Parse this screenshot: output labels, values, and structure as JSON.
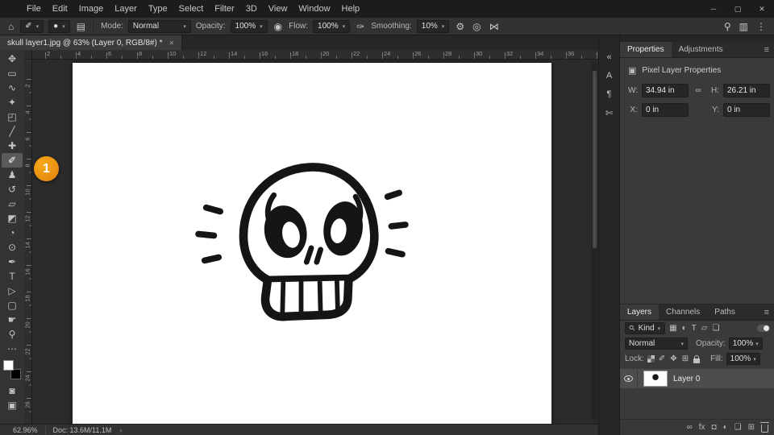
{
  "icons": {
    "home": "⌂",
    "chevron": "▾",
    "brush_preset": "✐",
    "brush_size_dot": "●",
    "brush_panel": "▤",
    "airbrush_opacity": "◉",
    "airbrush": "✑",
    "gear": "⚙",
    "pressure_size": "◎",
    "symmetry": "⋈",
    "search": "⚲",
    "workspace": "▥",
    "extras": "⋮",
    "link": "∞",
    "panel_menu": "≡",
    "image": "▣",
    "kind_search": "⚲",
    "ellipsis": "⋯",
    "quick_mask": "◙",
    "screen_mode": "▣",
    "status_chevron": "›"
  },
  "titlebar": {
    "menus": [
      "File",
      "Edit",
      "Image",
      "Layer",
      "Type",
      "Select",
      "Filter",
      "3D",
      "View",
      "Window",
      "Help"
    ],
    "window_controls": [
      {
        "name": "minimize-button",
        "glyph": "─"
      },
      {
        "name": "maximize-button",
        "glyph": "▢"
      },
      {
        "name": "close-button",
        "glyph": "✕"
      }
    ]
  },
  "options_bar": {
    "mode_label": "Mode:",
    "mode_value": "Normal",
    "opacity_label": "Opacity:",
    "opacity_value": "100%",
    "flow_label": "Flow:",
    "flow_value": "100%",
    "smoothing_label": "Smoothing:",
    "smoothing_value": "10%"
  },
  "document_tab": {
    "title": "skull layer1.jpg @ 63% (Layer 0, RGB/8#) *",
    "close_glyph": "✕"
  },
  "rulers": {
    "top_numbers": [
      "2",
      "4",
      "6",
      "8",
      "10",
      "12",
      "14",
      "16",
      "18",
      "20",
      "22",
      "24",
      "26",
      "28",
      "30",
      "32",
      "34",
      "36"
    ],
    "left_numbers": [
      "2",
      "4",
      "6",
      "8",
      "10",
      "12",
      "14",
      "16",
      "18",
      "20",
      "22",
      "24",
      "26"
    ]
  },
  "toolbar": {
    "tools": [
      {
        "name": "move-tool",
        "glyph": "✥",
        "active": false
      },
      {
        "name": "rectangular-marquee-tool",
        "glyph": "▭",
        "active": false
      },
      {
        "name": "lasso-tool",
        "glyph": "∿",
        "active": false
      },
      {
        "name": "quick-selection-tool",
        "glyph": "✦",
        "active": false
      },
      {
        "name": "crop-tool",
        "glyph": "◰",
        "active": false
      },
      {
        "name": "eyedropper-tool",
        "glyph": "╱",
        "active": false
      },
      {
        "name": "spot-healing-brush-tool",
        "glyph": "✚",
        "active": false
      },
      {
        "name": "brush-tool",
        "glyph": "✐",
        "active": true
      },
      {
        "name": "clone-stamp-tool",
        "glyph": "♟",
        "active": false
      },
      {
        "name": "history-brush-tool",
        "glyph": "↺",
        "active": false
      },
      {
        "name": "eraser-tool",
        "glyph": "▱",
        "active": false
      },
      {
        "name": "gradient-tool",
        "glyph": "◩",
        "active": false
      },
      {
        "name": "blur-tool",
        "glyph": "◔",
        "active": false
      },
      {
        "name": "dodge-tool",
        "glyph": "⊙",
        "active": false
      },
      {
        "name": "pen-tool",
        "glyph": "✒",
        "active": false
      },
      {
        "name": "type-tool",
        "glyph": "T",
        "active": false
      },
      {
        "name": "path-selection-tool",
        "glyph": "▷",
        "active": false
      },
      {
        "name": "rectangle-tool",
        "glyph": "▢",
        "active": false
      },
      {
        "name": "hand-tool",
        "glyph": "☛",
        "active": false
      },
      {
        "name": "zoom-tool",
        "glyph": "⚲",
        "active": false
      }
    ],
    "foreground_color": "#ffffff",
    "background_color": "#000000"
  },
  "callout": {
    "number": "1",
    "color": "#e8890c"
  },
  "dock_strip": {
    "icons": [
      {
        "name": "expand-panels-icon",
        "glyph": "«"
      },
      {
        "name": "character-panel-icon",
        "glyph": "A"
      },
      {
        "name": "paragraph-panel-icon",
        "glyph": "¶"
      },
      {
        "name": "scissors-panel-icon",
        "glyph": "✄"
      }
    ]
  },
  "properties_panel": {
    "tabs": [
      {
        "label": "Properties",
        "active": true
      },
      {
        "label": "Adjustments",
        "active": false
      }
    ],
    "title": "Pixel Layer Properties",
    "w_label": "W:",
    "w_value": "34.94 in",
    "h_label": "H:",
    "h_value": "26.21 in",
    "x_label": "X:",
    "x_value": "0 in",
    "y_label": "Y:",
    "y_value": "0 in"
  },
  "layers_panel": {
    "tabs": [
      {
        "label": "Layers",
        "active": true
      },
      {
        "label": "Channels",
        "active": false
      },
      {
        "label": "Paths",
        "active": false
      }
    ],
    "kind_label": "Kind",
    "filter_icons": [
      {
        "name": "filter-pixel-layers-icon",
        "glyph": "▦"
      },
      {
        "name": "filter-adjustment-layers-icon",
        "glyph": "◐"
      },
      {
        "name": "filter-type-layers-icon",
        "glyph": "T"
      },
      {
        "name": "filter-shape-layers-icon",
        "glyph": "▱"
      },
      {
        "name": "filter-smart-objects-icon",
        "glyph": "❏"
      }
    ],
    "blend_mode": "Normal",
    "opacity_label": "Opacity:",
    "opacity_value": "100%",
    "lock_label": "Lock:",
    "lock_icons": [
      {
        "name": "lock-pixels-icon",
        "glyph": "✐"
      },
      {
        "name": "lock-position-icon",
        "glyph": "✥"
      },
      {
        "name": "lock-artboard-icon",
        "glyph": "⊞"
      }
    ],
    "fill_label": "Fill:",
    "fill_value": "100%",
    "layer_name": "Layer 0",
    "bottom_icons": [
      {
        "name": "link-layers-icon",
        "glyph": "∞"
      },
      {
        "name": "layer-style-icon",
        "glyph": "fx"
      },
      {
        "name": "add-mask-icon",
        "glyph": "◘"
      },
      {
        "name": "adjustment-layer-icon",
        "glyph": "◐"
      },
      {
        "name": "new-group-icon",
        "glyph": "❏"
      },
      {
        "name": "new-layer-icon",
        "glyph": "⊞"
      }
    ]
  },
  "status_bar": {
    "zoom": "62.96%",
    "doc": "Doc: 13.6M/11.1M"
  }
}
